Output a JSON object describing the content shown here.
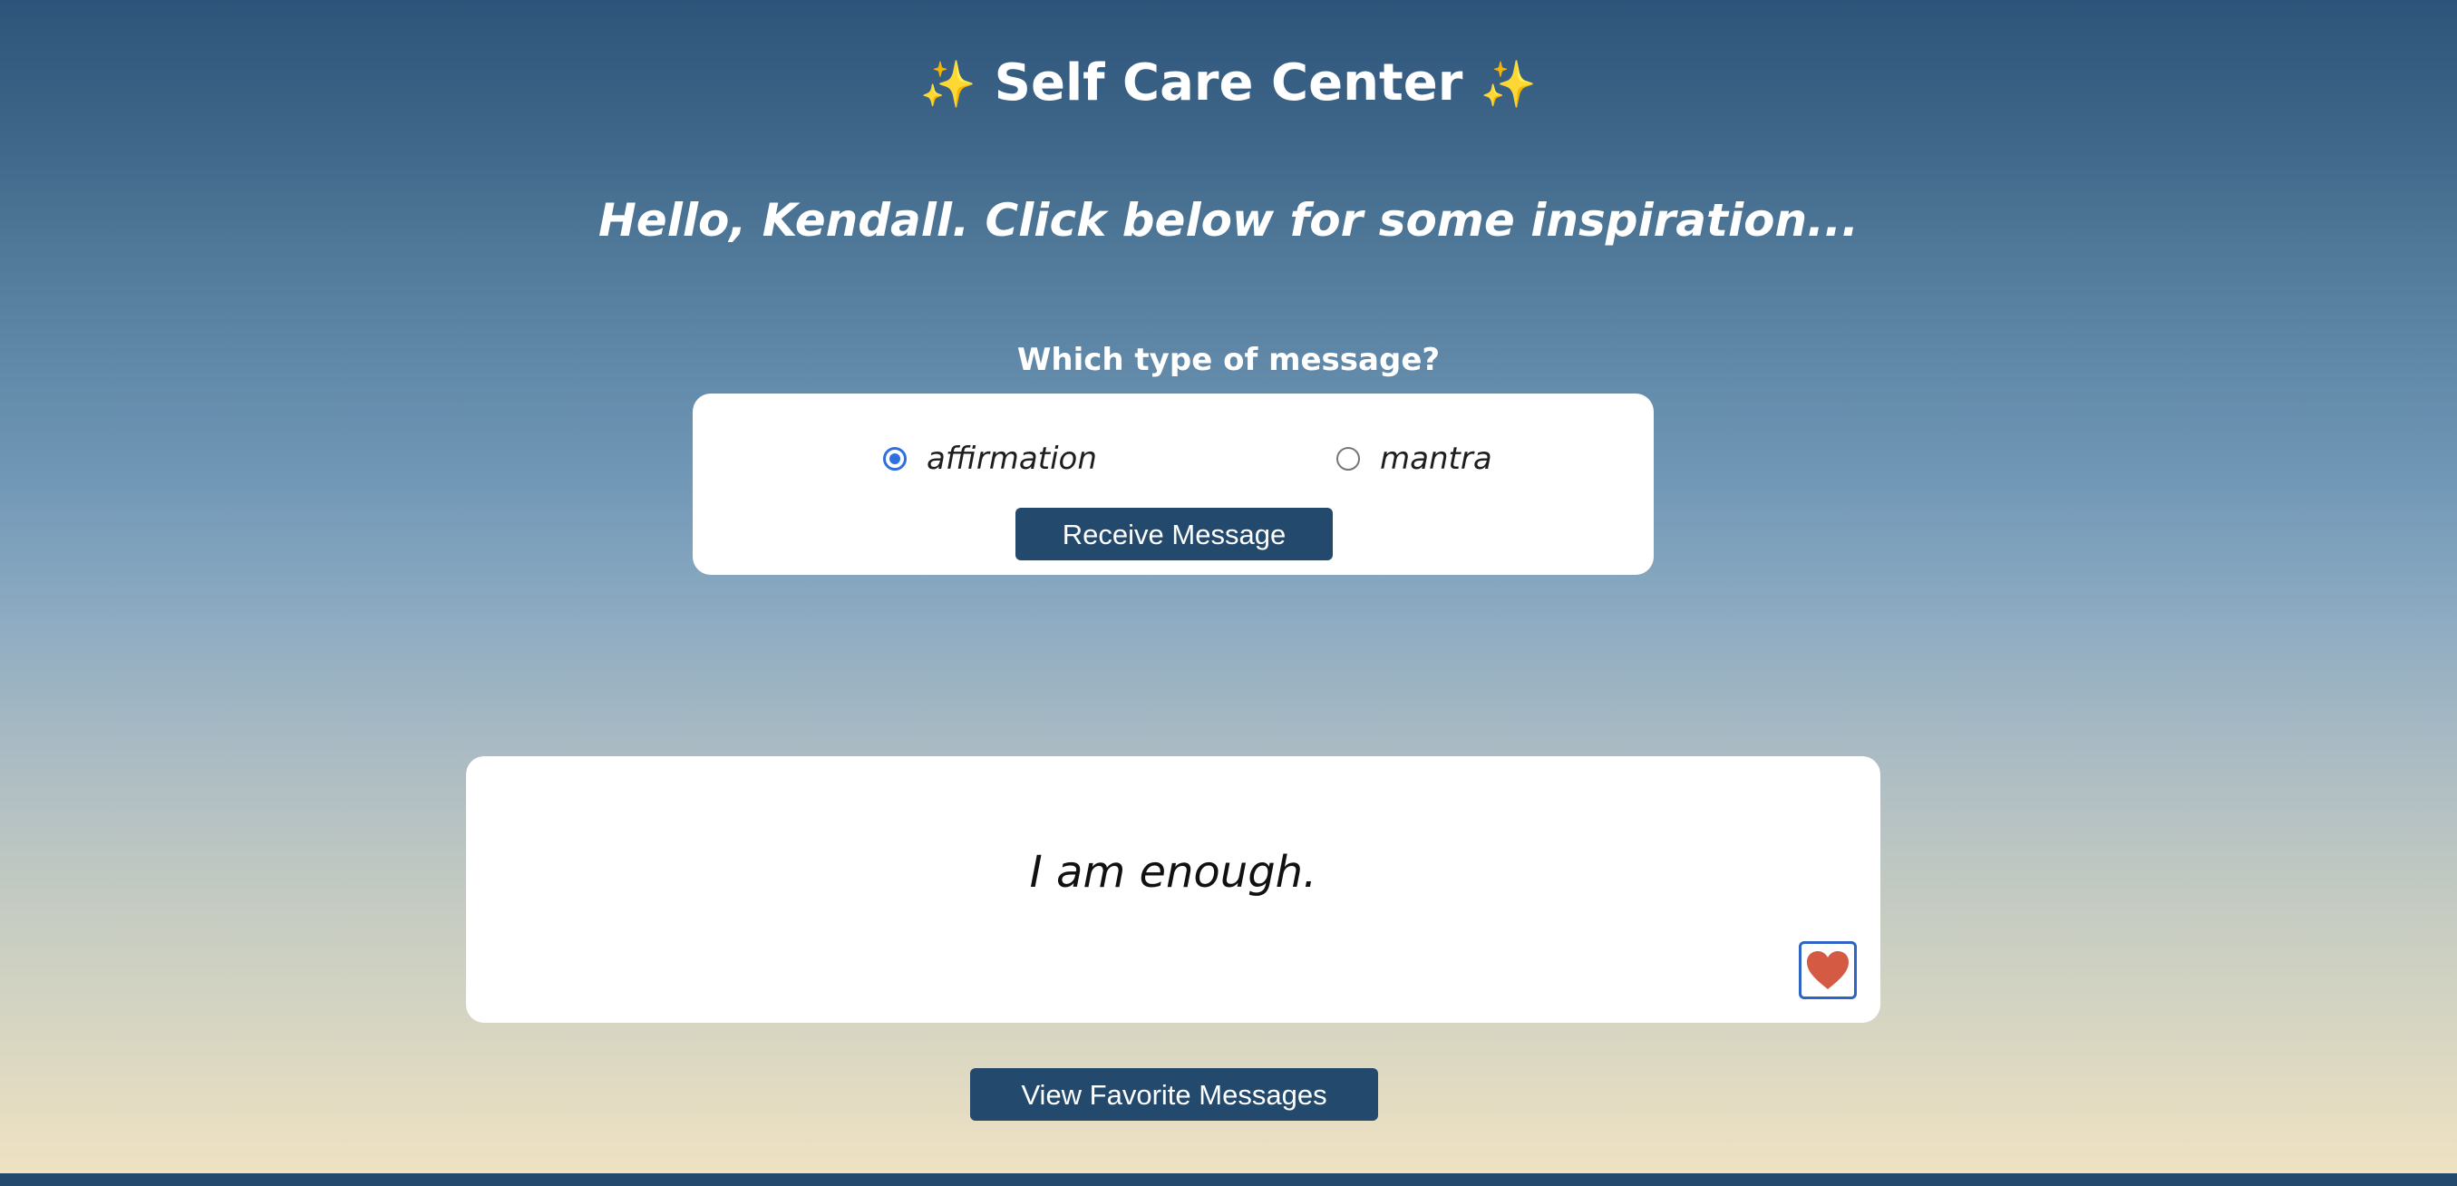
{
  "header": {
    "title": "Self Care Center",
    "sparkle_left": "✨",
    "sparkle_right": "✨"
  },
  "greeting": "Hello, Kendall. Click below for some inspiration...",
  "message_type": {
    "question": "Which type of message?",
    "options": [
      {
        "label": "affirmation",
        "selected": true
      },
      {
        "label": "mantra",
        "selected": false
      }
    ],
    "receive_label": "Receive Message"
  },
  "message": {
    "text": "I am enough.",
    "favorite_icon": "heart-icon",
    "favorited": true
  },
  "view_favorites_label": "View Favorite Messages",
  "colors": {
    "button": "#234a6d",
    "heart": "#d45a43",
    "radio_checked": "#2f6fe0",
    "sparkle": "#f4d35e"
  }
}
